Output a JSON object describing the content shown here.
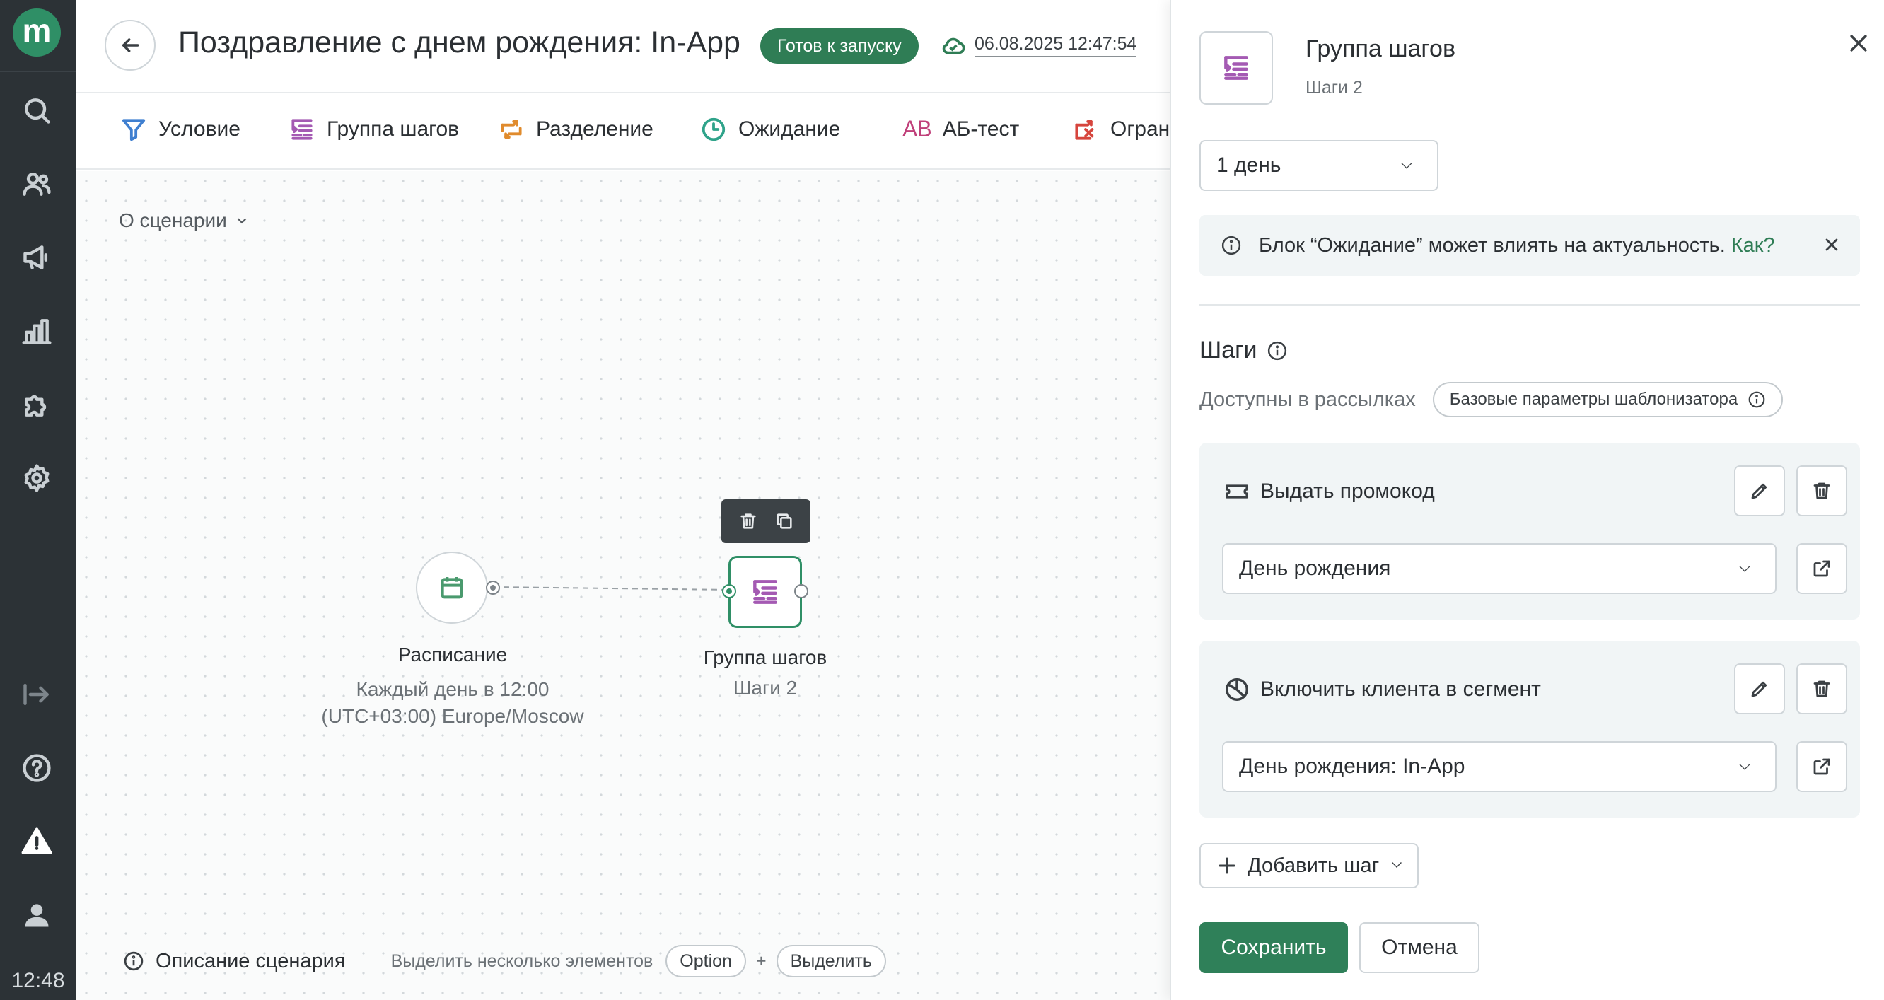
{
  "app": {
    "logo_letter": "m",
    "clock": "12:48"
  },
  "header": {
    "title": "Поздравление с днем рождения: In-App",
    "status": "Готов к запуску",
    "saved_at": "06.08.2025 12:47:54"
  },
  "toolbar": {
    "items": [
      {
        "label": "Условие",
        "icon": "filter-icon"
      },
      {
        "label": "Группа шагов",
        "icon": "steps-group-icon"
      },
      {
        "label": "Разделение",
        "icon": "split-icon"
      },
      {
        "label": "Ожидание",
        "icon": "clock-icon"
      },
      {
        "label": "АБ-тест",
        "icon": "ab-icon"
      },
      {
        "label": "Ограни",
        "icon": "limit-icon"
      }
    ],
    "ab_glyph": "AB"
  },
  "canvas": {
    "about_label": "О сценарии",
    "schedule_node": {
      "title": "Расписание",
      "line1": "Каждый день в 12:00",
      "line2": "(UTC+03:00) Europe/Moscow"
    },
    "group_node": {
      "title": "Группа шагов",
      "subtitle": "Шаги 2"
    },
    "bottom": {
      "description": "Описание сценария",
      "hint": "Выделить несколько элементов",
      "key": "Option",
      "plus": "+",
      "action": "Выделить"
    }
  },
  "panel": {
    "title": "Группа шагов",
    "subtitle": "Шаги 2",
    "wait_value": "1 день",
    "alert_text": "Блок “Ожидание” может влиять на актуальность.",
    "alert_link": "Как?",
    "steps_heading": "Шаги",
    "available_label": "Доступны в рассылках",
    "available_chip": "Базовые параметры шаблонизатора",
    "steps": [
      {
        "title": "Выдать промокод",
        "icon": "ticket-icon",
        "value": "День рождения"
      },
      {
        "title": "Включить клиента в сегмент",
        "icon": "segment-icon",
        "value": "День рождения: In-App"
      }
    ],
    "add_step": "Добавить шаг",
    "save": "Сохранить",
    "cancel": "Отмена"
  },
  "colors": {
    "accent": "#2f7d55",
    "rail": "#2c3236",
    "group_icon": "#a45ab3"
  }
}
